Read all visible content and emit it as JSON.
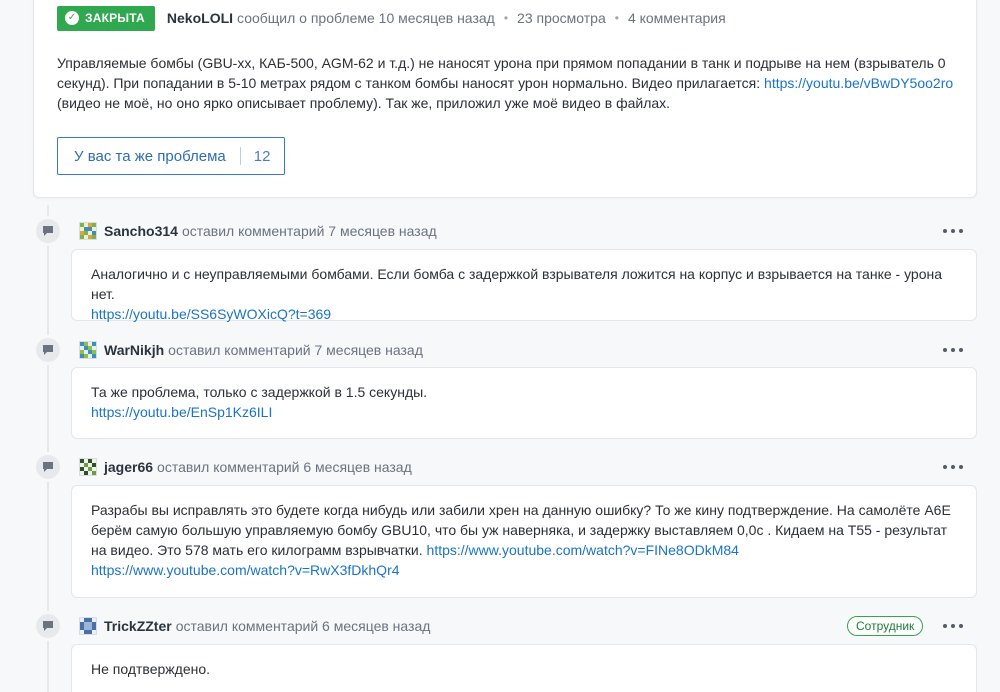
{
  "topic": {
    "status": "ЗАКРЫТА",
    "author": "NekoLOLI",
    "action": "сообщил о проблеме 10 месяцев назад",
    "views": "23 просмотра",
    "comments_count": "4 комментария",
    "body_text_1": "Управляемые бомбы (GBU-xx, КАБ-500, AGM-62 и т.д.) не наносят урона при прямом попадании в танк и подрыве на нем (взрыватель 0 секунд). При попадании в 5-10 метрах рядом с танком бомбы наносят урон нормально. Видео прилагается: ",
    "body_link": "https://youtu.be/vBwDY5oo2ro",
    "body_text_2": " (видео не моё, но оно ярко описывает проблему). Так же, приложил уже моё видео в файлах.",
    "same_problem_label": "У вас та же проблема",
    "same_problem_count": "12"
  },
  "comments": [
    {
      "author": "Sancho314",
      "meta": "оставил комментарий 7 месяцев назад",
      "text": "Аналогично и с неуправляемыми бомбами. Если бомба с задержкой взрывателя ложится на корпус и взрывается на танке - урона нет.",
      "link1": "https://youtu.be/SS6SyWOXicQ?t=369"
    },
    {
      "author": "WarNikjh",
      "meta": "оставил комментарий 7 месяцев назад",
      "text": "Та же проблема, только с задержкой в 1.5 секунды.",
      "link1": "https://youtu.be/EnSp1Kz6ILI"
    },
    {
      "author": "jager66",
      "meta": "оставил комментарий 6 месяцев назад",
      "text": "Разрабы вы исправлять это будете когда нибудь или забили хрен на данную ошибку? То же кину подтверждение. На самолёте A6E берём самую большую управляемую бомбу GBU10, что бы уж наверняка, и задержку выставляем 0,0с . Кидаем на T55 - результат на видео. Это 578 мать его килограмм взрывчатки. ",
      "link1": "https://www.youtube.com/watch?v=FINe8ODkM84",
      "link2": "https://www.youtube.com/watch?v=RwX3fDkhQr4"
    },
    {
      "author": "TrickZZter",
      "meta": "оставил комментарий 6 месяцев назад",
      "badge": "Сотрудник",
      "text": "Не подтверждено."
    }
  ],
  "icons": {
    "status": "check-circle-icon",
    "comment": "speech-bubble-icon",
    "more": "more-horizontal-icon"
  },
  "colors": {
    "closed_green": "#2fa84f",
    "link_blue": "#1a73c7",
    "button_blue": "#3a79c4"
  }
}
